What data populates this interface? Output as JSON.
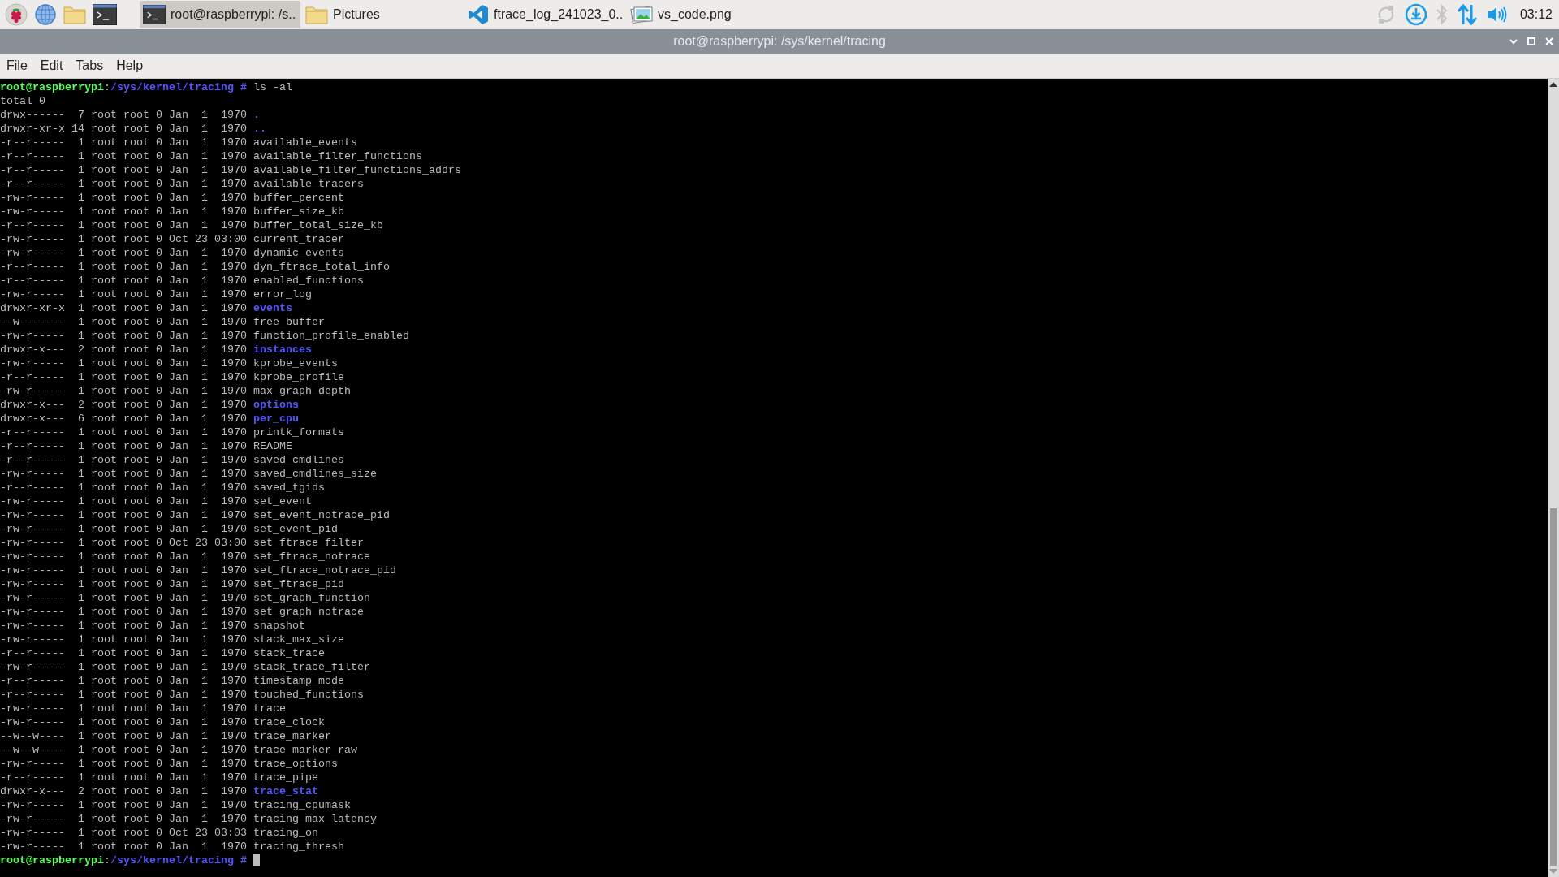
{
  "taskbar": {
    "tasks": [
      {
        "kind": "terminal",
        "label": "root@raspberrypi: /s..",
        "selected": true
      },
      {
        "kind": "folder",
        "label": "Pictures",
        "selected": false
      },
      {
        "kind": "vscode",
        "label": "ftrace_log_241023_0..",
        "selected": false
      },
      {
        "kind": "image",
        "label": "vs_code.png",
        "selected": false
      }
    ],
    "clock": "03:12"
  },
  "window": {
    "title": "root@raspberrypi: /sys/kernel/tracing"
  },
  "menu": [
    "File",
    "Edit",
    "Tabs",
    "Help"
  ],
  "terminal": {
    "lines": [
      {
        "kind": "prompt",
        "user": "root@raspberrypi",
        "sep": ":",
        "path": "/sys/kernel/tracing",
        "symbol": "#",
        "command": "ls -al"
      },
      {
        "kind": "text",
        "text": "total 0"
      },
      {
        "kind": "dir",
        "info": "drwx------  7 root root 0 Jan  1  1970",
        "name": "."
      },
      {
        "kind": "dir",
        "info": "drwxr-xr-x 14 root root 0 Jan  1  1970",
        "name": ".."
      },
      {
        "kind": "file",
        "info": "-r--r-----  1 root root 0 Jan  1  1970",
        "name": "available_events"
      },
      {
        "kind": "file",
        "info": "-r--r-----  1 root root 0 Jan  1  1970",
        "name": "available_filter_functions"
      },
      {
        "kind": "file",
        "info": "-r--r-----  1 root root 0 Jan  1  1970",
        "name": "available_filter_functions_addrs"
      },
      {
        "kind": "file",
        "info": "-r--r-----  1 root root 0 Jan  1  1970",
        "name": "available_tracers"
      },
      {
        "kind": "file",
        "info": "-rw-r-----  1 root root 0 Jan  1  1970",
        "name": "buffer_percent"
      },
      {
        "kind": "file",
        "info": "-rw-r-----  1 root root 0 Jan  1  1970",
        "name": "buffer_size_kb"
      },
      {
        "kind": "file",
        "info": "-r--r-----  1 root root 0 Jan  1  1970",
        "name": "buffer_total_size_kb"
      },
      {
        "kind": "file",
        "info": "-rw-r-----  1 root root 0 Oct 23 03:00",
        "name": "current_tracer"
      },
      {
        "kind": "file",
        "info": "-rw-r-----  1 root root 0 Jan  1  1970",
        "name": "dynamic_events"
      },
      {
        "kind": "file",
        "info": "-r--r-----  1 root root 0 Jan  1  1970",
        "name": "dyn_ftrace_total_info"
      },
      {
        "kind": "file",
        "info": "-r--r-----  1 root root 0 Jan  1  1970",
        "name": "enabled_functions"
      },
      {
        "kind": "file",
        "info": "-rw-r-----  1 root root 0 Jan  1  1970",
        "name": "error_log"
      },
      {
        "kind": "dir",
        "info": "drwxr-xr-x  1 root root 0 Jan  1  1970",
        "name": "events"
      },
      {
        "kind": "file",
        "info": "--w-------  1 root root 0 Jan  1  1970",
        "name": "free_buffer"
      },
      {
        "kind": "file",
        "info": "-rw-r-----  1 root root 0 Jan  1  1970",
        "name": "function_profile_enabled"
      },
      {
        "kind": "dir",
        "info": "drwxr-x---  2 root root 0 Jan  1  1970",
        "name": "instances"
      },
      {
        "kind": "file",
        "info": "-rw-r-----  1 root root 0 Jan  1  1970",
        "name": "kprobe_events"
      },
      {
        "kind": "file",
        "info": "-r--r-----  1 root root 0 Jan  1  1970",
        "name": "kprobe_profile"
      },
      {
        "kind": "file",
        "info": "-rw-r-----  1 root root 0 Jan  1  1970",
        "name": "max_graph_depth"
      },
      {
        "kind": "dir",
        "info": "drwxr-x---  2 root root 0 Jan  1  1970",
        "name": "options"
      },
      {
        "kind": "dir",
        "info": "drwxr-x---  6 root root 0 Jan  1  1970",
        "name": "per_cpu"
      },
      {
        "kind": "file",
        "info": "-r--r-----  1 root root 0 Jan  1  1970",
        "name": "printk_formats"
      },
      {
        "kind": "file",
        "info": "-r--r-----  1 root root 0 Jan  1  1970",
        "name": "README"
      },
      {
        "kind": "file",
        "info": "-r--r-----  1 root root 0 Jan  1  1970",
        "name": "saved_cmdlines"
      },
      {
        "kind": "file",
        "info": "-rw-r-----  1 root root 0 Jan  1  1970",
        "name": "saved_cmdlines_size"
      },
      {
        "kind": "file",
        "info": "-r--r-----  1 root root 0 Jan  1  1970",
        "name": "saved_tgids"
      },
      {
        "kind": "file",
        "info": "-rw-r-----  1 root root 0 Jan  1  1970",
        "name": "set_event"
      },
      {
        "kind": "file",
        "info": "-rw-r-----  1 root root 0 Jan  1  1970",
        "name": "set_event_notrace_pid"
      },
      {
        "kind": "file",
        "info": "-rw-r-----  1 root root 0 Jan  1  1970",
        "name": "set_event_pid"
      },
      {
        "kind": "file",
        "info": "-rw-r-----  1 root root 0 Oct 23 03:00",
        "name": "set_ftrace_filter"
      },
      {
        "kind": "file",
        "info": "-rw-r-----  1 root root 0 Jan  1  1970",
        "name": "set_ftrace_notrace"
      },
      {
        "kind": "file",
        "info": "-rw-r-----  1 root root 0 Jan  1  1970",
        "name": "set_ftrace_notrace_pid"
      },
      {
        "kind": "file",
        "info": "-rw-r-----  1 root root 0 Jan  1  1970",
        "name": "set_ftrace_pid"
      },
      {
        "kind": "file",
        "info": "-rw-r-----  1 root root 0 Jan  1  1970",
        "name": "set_graph_function"
      },
      {
        "kind": "file",
        "info": "-rw-r-----  1 root root 0 Jan  1  1970",
        "name": "set_graph_notrace"
      },
      {
        "kind": "file",
        "info": "-rw-r-----  1 root root 0 Jan  1  1970",
        "name": "snapshot"
      },
      {
        "kind": "file",
        "info": "-rw-r-----  1 root root 0 Jan  1  1970",
        "name": "stack_max_size"
      },
      {
        "kind": "file",
        "info": "-r--r-----  1 root root 0 Jan  1  1970",
        "name": "stack_trace"
      },
      {
        "kind": "file",
        "info": "-rw-r-----  1 root root 0 Jan  1  1970",
        "name": "stack_trace_filter"
      },
      {
        "kind": "file",
        "info": "-r--r-----  1 root root 0 Jan  1  1970",
        "name": "timestamp_mode"
      },
      {
        "kind": "file",
        "info": "-r--r-----  1 root root 0 Jan  1  1970",
        "name": "touched_functions"
      },
      {
        "kind": "file",
        "info": "-rw-r-----  1 root root 0 Jan  1  1970",
        "name": "trace"
      },
      {
        "kind": "file",
        "info": "-rw-r-----  1 root root 0 Jan  1  1970",
        "name": "trace_clock"
      },
      {
        "kind": "file",
        "info": "--w--w----  1 root root 0 Jan  1  1970",
        "name": "trace_marker"
      },
      {
        "kind": "file",
        "info": "--w--w----  1 root root 0 Jan  1  1970",
        "name": "trace_marker_raw"
      },
      {
        "kind": "file",
        "info": "-rw-r-----  1 root root 0 Jan  1  1970",
        "name": "trace_options"
      },
      {
        "kind": "file",
        "info": "-r--r-----  1 root root 0 Jan  1  1970",
        "name": "trace_pipe"
      },
      {
        "kind": "dir",
        "info": "drwxr-x---  2 root root 0 Jan  1  1970",
        "name": "trace_stat"
      },
      {
        "kind": "file",
        "info": "-rw-r-----  1 root root 0 Jan  1  1970",
        "name": "tracing_cpumask"
      },
      {
        "kind": "file",
        "info": "-rw-r-----  1 root root 0 Jan  1  1970",
        "name": "tracing_max_latency"
      },
      {
        "kind": "file",
        "info": "-rw-r-----  1 root root 0 Oct 23 03:03",
        "name": "tracing_on"
      },
      {
        "kind": "file",
        "info": "-rw-r-----  1 root root 0 Jan  1  1970",
        "name": "tracing_thresh"
      },
      {
        "kind": "prompt",
        "user": "root@raspberrypi",
        "sep": ":",
        "path": "/sys/kernel/tracing",
        "symbol": "#",
        "cursor": true
      }
    ]
  }
}
